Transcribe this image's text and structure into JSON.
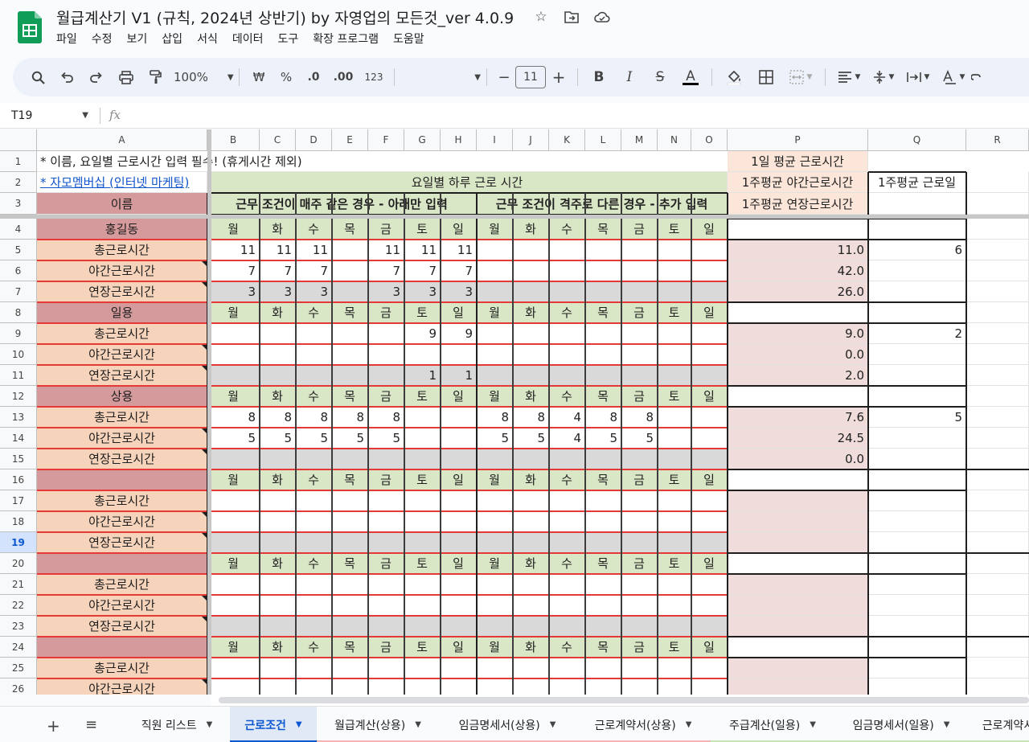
{
  "doc": {
    "title": "월급계산기 V1 (규칙, 2024년 상반기) by 자영업의 모든것_ver 4.0.9",
    "menus": [
      "파일",
      "수정",
      "보기",
      "삽입",
      "서식",
      "데이터",
      "도구",
      "확장 프로그램",
      "도움말"
    ]
  },
  "icons": {
    "star": "star-icon",
    "move": "move-to-folder-icon",
    "cloud": "cloud-status-icon",
    "search": "search-icon",
    "undo": "undo-icon",
    "redo": "redo-icon",
    "print": "print-icon",
    "paint": "paint-format-icon"
  },
  "toolbar": {
    "zoom": "100%",
    "currency": "₩",
    "percent": "%",
    "dec_decrease": ".0",
    "dec_increase": ".00",
    "number_format": "123",
    "minus": "−",
    "font_size": "11",
    "plus": "+",
    "bold": "B",
    "italic": "I",
    "strike": "S",
    "text_color": "A"
  },
  "formula_bar": {
    "cell_ref": "T19",
    "fx": "fx"
  },
  "columns": [
    "A",
    "B",
    "C",
    "D",
    "E",
    "F",
    "G",
    "H",
    "I",
    "J",
    "K",
    "L",
    "M",
    "N",
    "O",
    "P",
    "Q",
    "R"
  ],
  "rows": [
    "1",
    "2",
    "3",
    "4",
    "5",
    "6",
    "7",
    "8",
    "9",
    "10",
    "11",
    "12",
    "13",
    "14",
    "15",
    "16",
    "17",
    "18",
    "19",
    "20",
    "21",
    "22",
    "23",
    "24",
    "25",
    "26"
  ],
  "active_row": "19",
  "header": {
    "r1_note": "* 이름, 요일별 근로시간 입력 필수! (휴게시간 제외)",
    "r2_link": "* 자모멤버십 (인터넷 마케팅)",
    "r2_daily": "요일별 하루 근로 시간",
    "r3_name": "이름",
    "r3_same": "근무 조건이 매주 같은 경우 - 아래만 입력",
    "r3_alt": "근무 조건이 격주로 다른 경우 - 추가 입력",
    "p1": "1일 평균 근로시간",
    "p2": "1주평균 야간근로시간",
    "p3": "1주평균 연장근로시간",
    "q2": "1주평균 근로일"
  },
  "days": [
    "월",
    "화",
    "수",
    "목",
    "금",
    "토",
    "일",
    "월",
    "화",
    "수",
    "목",
    "금",
    "토",
    "일"
  ],
  "row_labels": {
    "total": "총근로시간",
    "night": "야간근로시간",
    "overtime": "연장근로시간"
  },
  "employees": [
    {
      "name": "홍길동",
      "total": [
        "11",
        "11",
        "11",
        "",
        "11",
        "11",
        "11",
        "",
        "",
        "",
        "",
        "",
        "",
        ""
      ],
      "night": [
        "7",
        "7",
        "7",
        "",
        "7",
        "7",
        "7",
        "",
        "",
        "",
        "",
        "",
        "",
        ""
      ],
      "overtime": [
        "3",
        "3",
        "3",
        "",
        "3",
        "3",
        "3",
        "",
        "",
        "",
        "",
        "",
        "",
        ""
      ],
      "avg_daily": "11.0",
      "avg_night": "42.0",
      "avg_overtime": "26.0",
      "work_days": "6"
    },
    {
      "name": "일용",
      "total": [
        "",
        "",
        "",
        "",
        "",
        "9",
        "9",
        "",
        "",
        "",
        "",
        "",
        "",
        ""
      ],
      "night": [
        "",
        "",
        "",
        "",
        "",
        "",
        "",
        "",
        "",
        "",
        "",
        "",
        "",
        ""
      ],
      "overtime": [
        "",
        "",
        "",
        "",
        "",
        "1",
        "1",
        "",
        "",
        "",
        "",
        "",
        "",
        ""
      ],
      "avg_daily": "9.0",
      "avg_night": "0.0",
      "avg_overtime": "2.0",
      "work_days": "2"
    },
    {
      "name": "상용",
      "total": [
        "8",
        "8",
        "8",
        "8",
        "8",
        "",
        "",
        "8",
        "8",
        "4",
        "8",
        "8",
        "",
        ""
      ],
      "night": [
        "5",
        "5",
        "5",
        "5",
        "5",
        "",
        "",
        "5",
        "5",
        "4",
        "5",
        "5",
        "",
        ""
      ],
      "overtime": [
        "",
        "",
        "",
        "",
        "",
        "",
        "",
        "",
        "",
        "",
        "",
        "",
        "",
        ""
      ],
      "avg_daily": "7.6",
      "avg_night": "24.5",
      "avg_overtime": "0.0",
      "work_days": "5"
    },
    {
      "name": "",
      "total": [
        "",
        "",
        "",
        "",
        "",
        "",
        "",
        "",
        "",
        "",
        "",
        "",
        "",
        ""
      ],
      "night": [
        "",
        "",
        "",
        "",
        "",
        "",
        "",
        "",
        "",
        "",
        "",
        "",
        "",
        ""
      ],
      "overtime": [
        "",
        "",
        "",
        "",
        "",
        "",
        "",
        "",
        "",
        "",
        "",
        "",
        "",
        ""
      ],
      "avg_daily": "",
      "avg_night": "",
      "avg_overtime": "",
      "work_days": ""
    },
    {
      "name": "",
      "total": [
        "",
        "",
        "",
        "",
        "",
        "",
        "",
        "",
        "",
        "",
        "",
        "",
        "",
        ""
      ],
      "night": [
        "",
        "",
        "",
        "",
        "",
        "",
        "",
        "",
        "",
        "",
        "",
        "",
        "",
        ""
      ],
      "overtime": [
        "",
        "",
        "",
        "",
        "",
        "",
        "",
        "",
        "",
        "",
        "",
        "",
        "",
        ""
      ],
      "avg_daily": "",
      "avg_night": "",
      "avg_overtime": "",
      "work_days": ""
    },
    {
      "name": "",
      "total": [
        "",
        "",
        "",
        "",
        "",
        "",
        "",
        "",
        "",
        "",
        "",
        "",
        "",
        ""
      ],
      "night": [
        "",
        "",
        "",
        "",
        "",
        "",
        "",
        "",
        "",
        "",
        "",
        "",
        "",
        ""
      ],
      "overtime": [],
      "avg_daily": "",
      "avg_night": "",
      "avg_overtime": "",
      "work_days": ""
    }
  ],
  "colors": {
    "name_fill": "#d59a9c",
    "label_fill": "#f6d3bb",
    "day_fill": "#d9e7c7",
    "p_head_fill": "#fbe6d9",
    "p_value_fill": "#efdcdb",
    "gray_fill": "#d9d9d9",
    "red_line": "#e53935"
  },
  "tabs": {
    "add": "+",
    "all": "≡",
    "items": [
      {
        "label": "직원 리스트",
        "active": false,
        "color": ""
      },
      {
        "label": "근로조건",
        "active": true,
        "color": ""
      },
      {
        "label": "월급계산(상용)",
        "active": false,
        "color": "#f4b6b5"
      },
      {
        "label": "임금명세서(상용)",
        "active": false,
        "color": "#f4b6b5"
      },
      {
        "label": "근로계약서(상용)",
        "active": false,
        "color": "#f4b6b5"
      },
      {
        "label": "주급계산(일용)",
        "active": false,
        "color": "#c7e6b4"
      },
      {
        "label": "임금명세서(일용)",
        "active": false,
        "color": "#c7e6b4"
      },
      {
        "label": "근로계약서",
        "active": false,
        "color": "#c7e6b4"
      }
    ]
  }
}
